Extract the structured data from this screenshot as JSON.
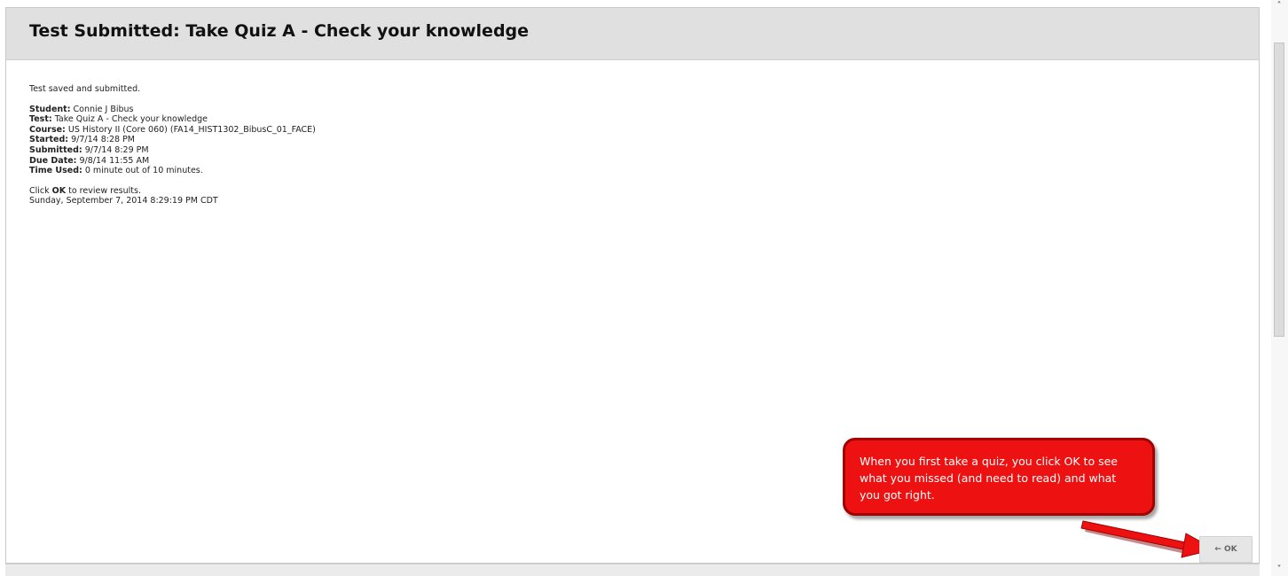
{
  "page": {
    "title": "Test Submitted: Take Quiz A - Check your knowledge"
  },
  "content": {
    "saved_message": "Test saved and submitted.",
    "details": [
      {
        "label": "Student:",
        "value": " Connie J Bibus"
      },
      {
        "label": "Test:",
        "value": " Take Quiz A - Check your knowledge"
      },
      {
        "label": "Course:",
        "value": " US History II (Core 060) (FA14_HIST1302_BibusC_01_FACE)"
      },
      {
        "label": "Started:",
        "value": " 9/7/14 8:28 PM"
      },
      {
        "label": "Submitted:",
        "value": " 9/7/14 8:29 PM"
      },
      {
        "label": "Due Date:",
        "value": " 9/8/14 11:55 AM"
      },
      {
        "label": "Time Used:",
        "value": " 0 minute out of 10 minutes."
      }
    ],
    "instruction_prefix": "Click ",
    "instruction_bold": "OK",
    "instruction_suffix": " to review results.",
    "timestamp": "Sunday, September 7, 2014 8:29:19 PM CDT"
  },
  "ok_button": {
    "arrow": "←",
    "label": "OK"
  },
  "callout": {
    "text": "When you first take a quiz, you click OK to see what you missed (and need to read) and what you got right.",
    "fill_color": "#ee1111",
    "border_color": "#a00000"
  },
  "scrollbar": {
    "up_glyph": "˄",
    "down_glyph": "˅"
  }
}
